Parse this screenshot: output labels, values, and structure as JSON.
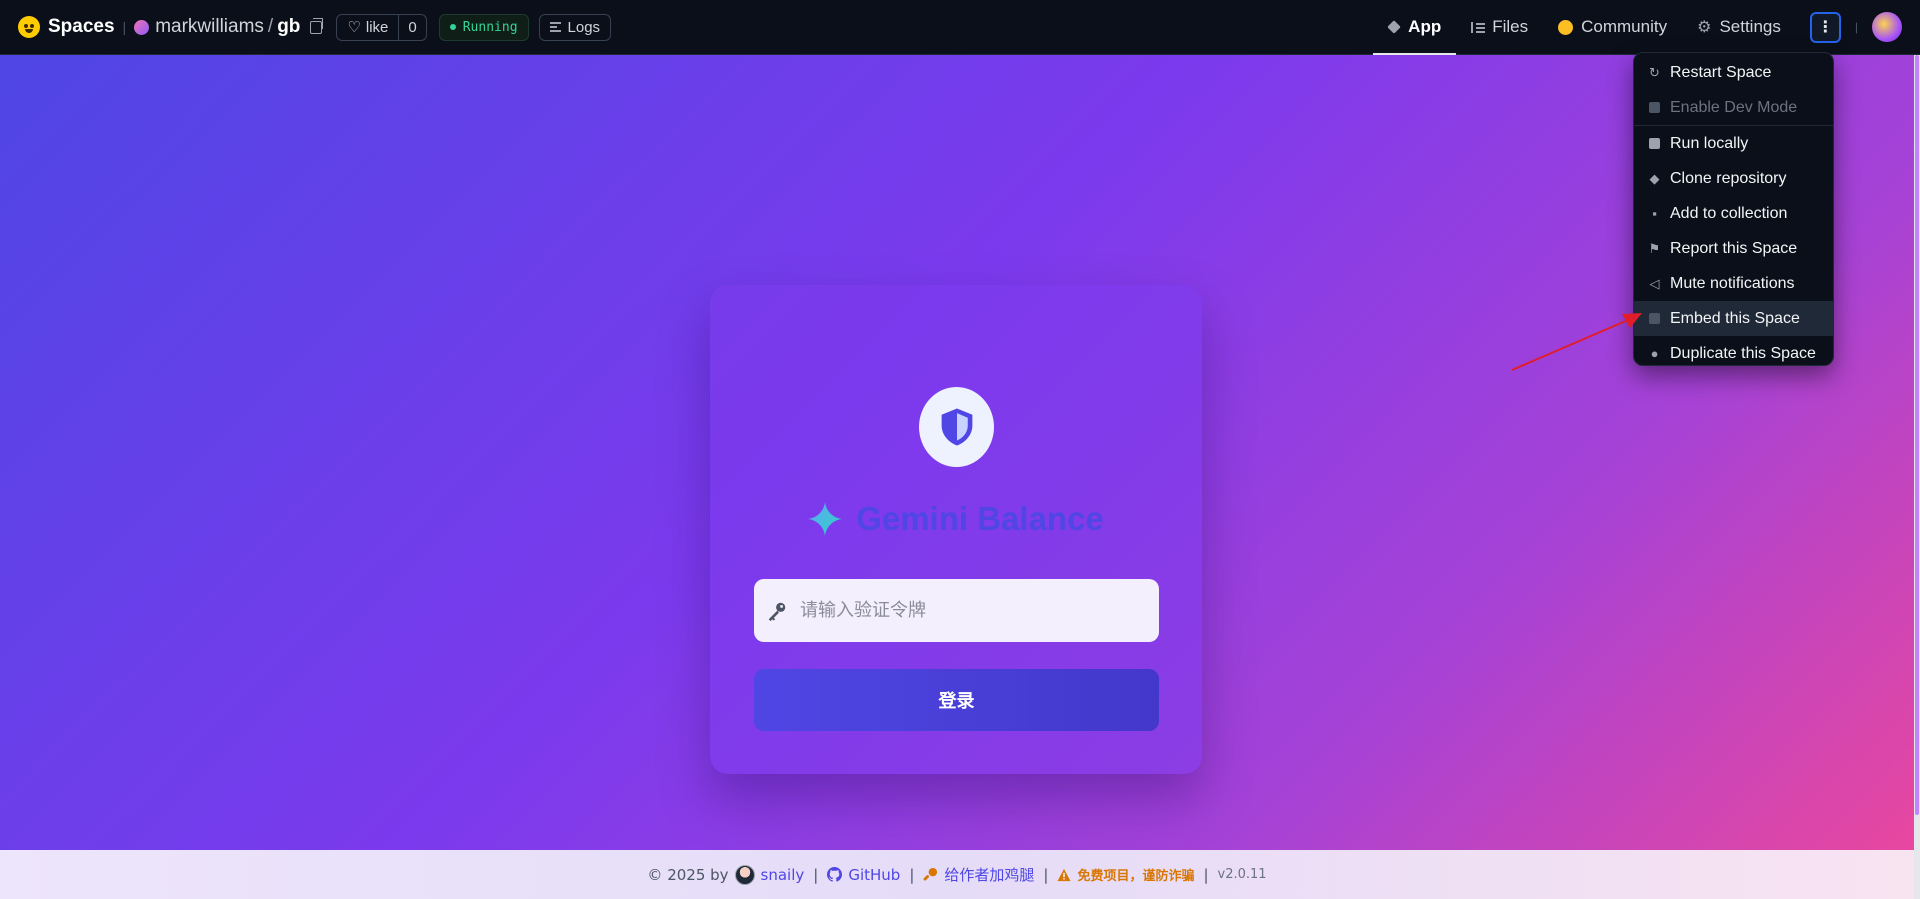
{
  "navbar": {
    "brand": "Spaces",
    "owner": "markwilliams",
    "repo": "gb",
    "like_label": "like",
    "like_count": "0",
    "status": "Running",
    "logs_label": "Logs",
    "tabs": [
      {
        "label": "App",
        "icon": "cube-icon",
        "active": true
      },
      {
        "label": "Files",
        "icon": "files-icon"
      },
      {
        "label": "Community",
        "icon": "community-icon"
      },
      {
        "label": "Settings",
        "icon": "gear-icon"
      }
    ]
  },
  "dropdown": {
    "items": [
      {
        "label": "Restart Space",
        "icon": "restart-icon"
      },
      {
        "label": "Enable Dev Mode",
        "icon": "terminal-icon",
        "disabled": true
      },
      {
        "label": "Run locally",
        "icon": "laptop-icon"
      },
      {
        "label": "Clone repository",
        "icon": "git-icon"
      },
      {
        "label": "Add to collection",
        "icon": "collection-icon"
      },
      {
        "label": "Report this Space",
        "icon": "flag-icon"
      },
      {
        "label": "Mute notifications",
        "icon": "mute-icon"
      },
      {
        "label": "Embed this Space",
        "icon": "embed-icon",
        "hovered": true
      },
      {
        "label": "Duplicate this Space",
        "icon": "duplicate-icon"
      }
    ]
  },
  "login": {
    "title": "Gemini Balance",
    "token_placeholder": "请输入验证令牌",
    "token_value": "",
    "submit_label": "登录"
  },
  "footer": {
    "copyright": "© 2025 by",
    "author": "snaily",
    "github": "GitHub",
    "feed": "给作者加鸡腿",
    "warning": "免费项目，谨防诈骗",
    "version": "v2.0.11"
  },
  "colors": {
    "accent": "#4f46e5",
    "status_green": "#34d399",
    "warning": "#d97706",
    "annotation_arrow": "#e11d2a"
  }
}
